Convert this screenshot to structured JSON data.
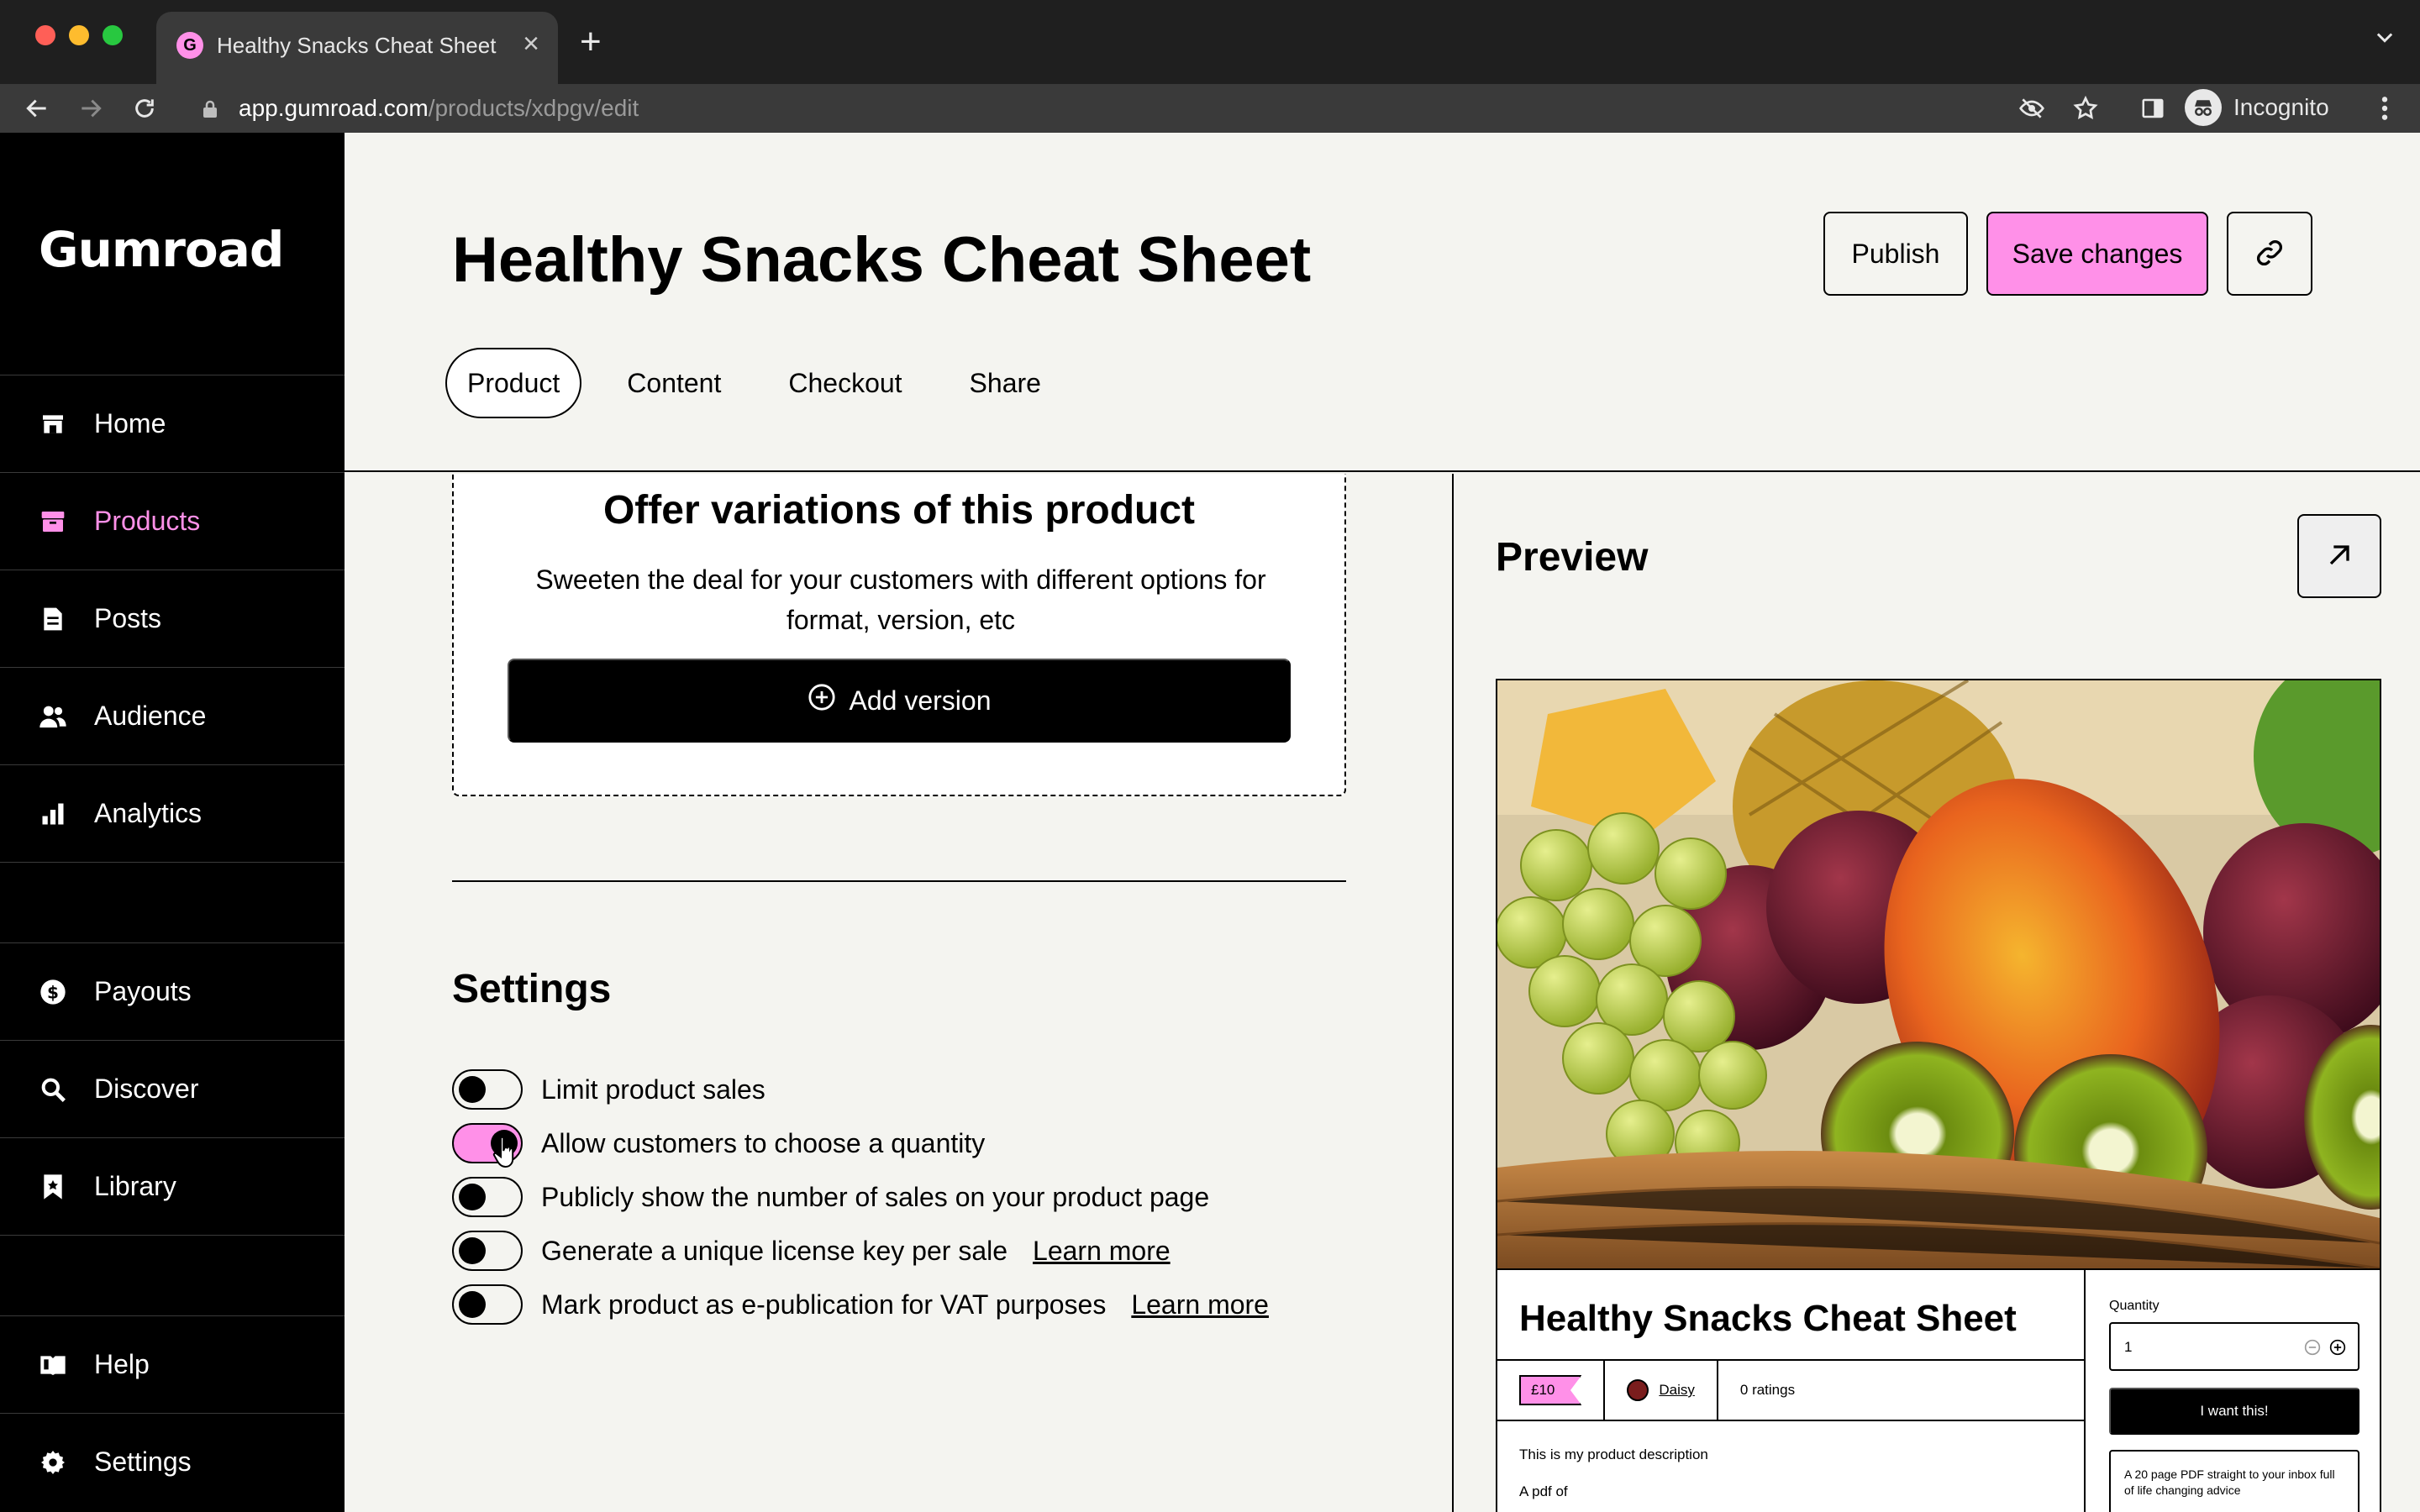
{
  "browser": {
    "tab_title": "Healthy Snacks Cheat Sheet",
    "tab_favicon": "G",
    "url_host": "app.gumroad.com",
    "url_path": "/products/xdpgv/edit",
    "profile_label": "Incognito"
  },
  "sidebar": {
    "logo": "Gumroad",
    "items": [
      {
        "label": "Home",
        "icon": "store-icon"
      },
      {
        "label": "Products",
        "icon": "archive-icon"
      },
      {
        "label": "Posts",
        "icon": "document-icon"
      },
      {
        "label": "Audience",
        "icon": "people-icon"
      },
      {
        "label": "Analytics",
        "icon": "bar-chart-icon"
      },
      {
        "label": "Payouts",
        "icon": "dollar-icon"
      },
      {
        "label": "Discover",
        "icon": "search-icon"
      },
      {
        "label": "Library",
        "icon": "bookmark-icon"
      },
      {
        "label": "Help",
        "icon": "book-icon"
      },
      {
        "label": "Settings",
        "icon": "gear-icon"
      }
    ],
    "active": "Products"
  },
  "header": {
    "title": "Healthy Snacks Cheat Sheet",
    "publish_label": "Publish",
    "save_label": "Save changes",
    "tabs": [
      "Product",
      "Content",
      "Checkout",
      "Share"
    ],
    "active_tab": "Product"
  },
  "variations": {
    "title": "Offer variations of this product",
    "description": "Sweeten the deal for your customers with different options for format, version, etc",
    "add_button": "Add version"
  },
  "settings": {
    "title": "Settings",
    "toggles": [
      {
        "label": "Limit product sales",
        "on": false
      },
      {
        "label": "Allow customers to choose a quantity",
        "on": true
      },
      {
        "label": "Publicly show the number of sales on your product page",
        "on": false
      },
      {
        "label": "Generate a unique license key per sale",
        "on": false,
        "link": "Learn more"
      },
      {
        "label": "Mark product as e-publication for VAT purposes",
        "on": false,
        "link": "Learn more"
      }
    ]
  },
  "preview": {
    "title": "Preview",
    "product_name": "Healthy Snacks Cheat Sheet",
    "price": "£10",
    "creator": "Daisy",
    "ratings": "0 ratings",
    "description_line1": "This is my product description",
    "description_line2": "A pdf of",
    "quantity_label": "Quantity",
    "quantity_value": "1",
    "buy_label": "I want this!",
    "summary": "A 20 page PDF straight to your inbox full of life changing advice"
  },
  "colors": {
    "accent": "#ff90e8",
    "sidebar_bg": "#000000",
    "page_bg": "#f4f4f0"
  }
}
